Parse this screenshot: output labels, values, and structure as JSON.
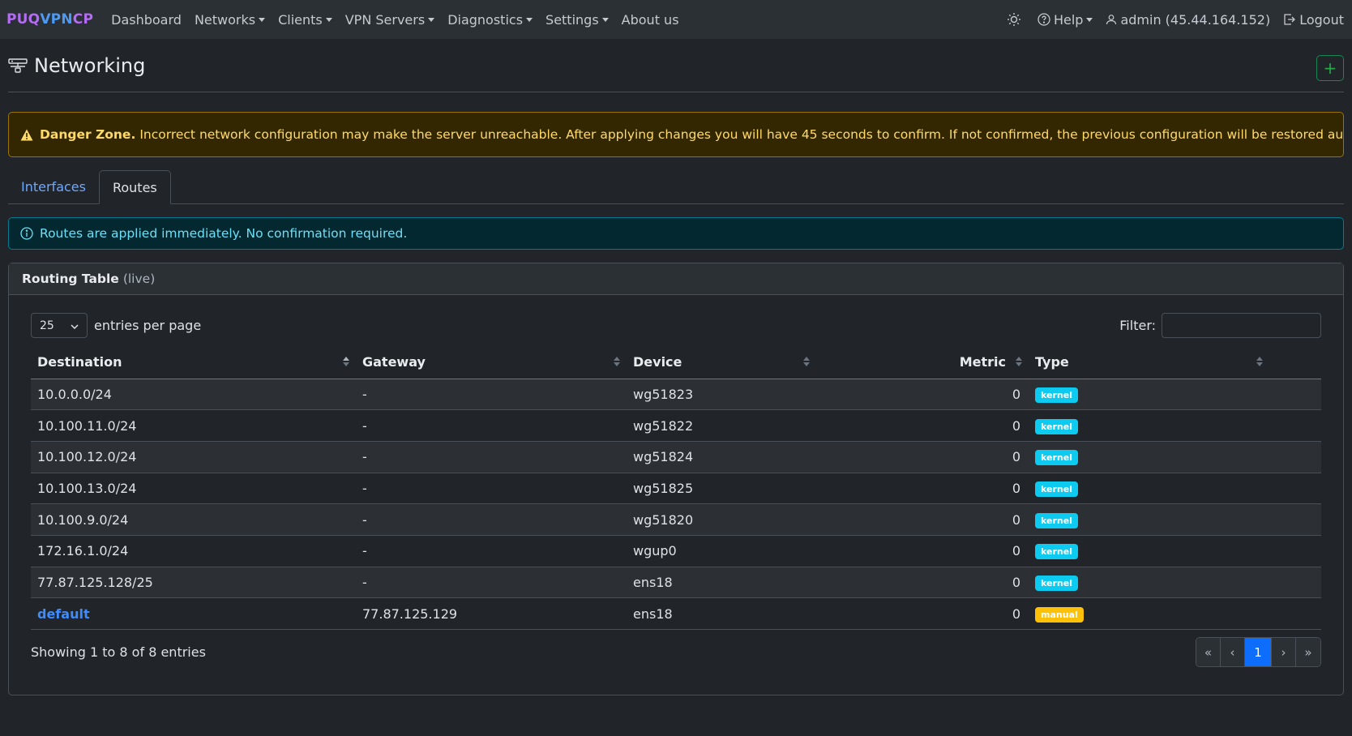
{
  "brand": {
    "part1": "PUQ",
    "part2": "VPN",
    "part3": "CP"
  },
  "nav": {
    "items": [
      {
        "label": "Dashboard",
        "dropdown": false
      },
      {
        "label": "Networks",
        "dropdown": true
      },
      {
        "label": "Clients",
        "dropdown": true
      },
      {
        "label": "VPN Servers",
        "dropdown": true
      },
      {
        "label": "Diagnostics",
        "dropdown": true
      },
      {
        "label": "Settings",
        "dropdown": true
      },
      {
        "label": "About us",
        "dropdown": false
      }
    ],
    "help_label": "Help",
    "user_label": "admin (45.44.164.152)",
    "logout_label": "Logout",
    "theme_icon": "sun-icon"
  },
  "page": {
    "title": "Networking",
    "add_label": "+"
  },
  "danger": {
    "title": "Danger Zone.",
    "text": "Incorrect network configuration may make the server unreachable. After applying changes you will have 45 seconds to confirm. If not confirmed, the previous configuration will be restored automatically."
  },
  "tabs": [
    {
      "label": "Interfaces",
      "active": false
    },
    {
      "label": "Routes",
      "active": true
    }
  ],
  "info": {
    "text": "Routes are applied immediately. No confirmation required."
  },
  "card": {
    "title": "Routing Table",
    "subtitle": "(live)"
  },
  "table": {
    "per_page": "25",
    "per_page_label": "entries per page",
    "filter_label": "Filter:",
    "filter_value": "",
    "columns": [
      "Destination",
      "Gateway",
      "Device",
      "Metric",
      "Type"
    ],
    "rows": [
      {
        "destination": "10.0.0.0/24",
        "gateway": "-",
        "device": "wg51823",
        "metric": "0",
        "type": "kernel",
        "link": false
      },
      {
        "destination": "10.100.11.0/24",
        "gateway": "-",
        "device": "wg51822",
        "metric": "0",
        "type": "kernel",
        "link": false
      },
      {
        "destination": "10.100.12.0/24",
        "gateway": "-",
        "device": "wg51824",
        "metric": "0",
        "type": "kernel",
        "link": false
      },
      {
        "destination": "10.100.13.0/24",
        "gateway": "-",
        "device": "wg51825",
        "metric": "0",
        "type": "kernel",
        "link": false
      },
      {
        "destination": "10.100.9.0/24",
        "gateway": "-",
        "device": "wg51820",
        "metric": "0",
        "type": "kernel",
        "link": false
      },
      {
        "destination": "172.16.1.0/24",
        "gateway": "-",
        "device": "wgup0",
        "metric": "0",
        "type": "kernel",
        "link": false
      },
      {
        "destination": "77.87.125.128/25",
        "gateway": "-",
        "device": "ens18",
        "metric": "0",
        "type": "kernel",
        "link": false
      },
      {
        "destination": "default",
        "gateway": "77.87.125.129",
        "device": "ens18",
        "metric": "0",
        "type": "manual",
        "link": true
      }
    ],
    "showing": "Showing 1 to 8 of 8 entries",
    "pager": {
      "first": "«",
      "prev": "‹",
      "current": "1",
      "next": "›",
      "last": "»"
    }
  }
}
